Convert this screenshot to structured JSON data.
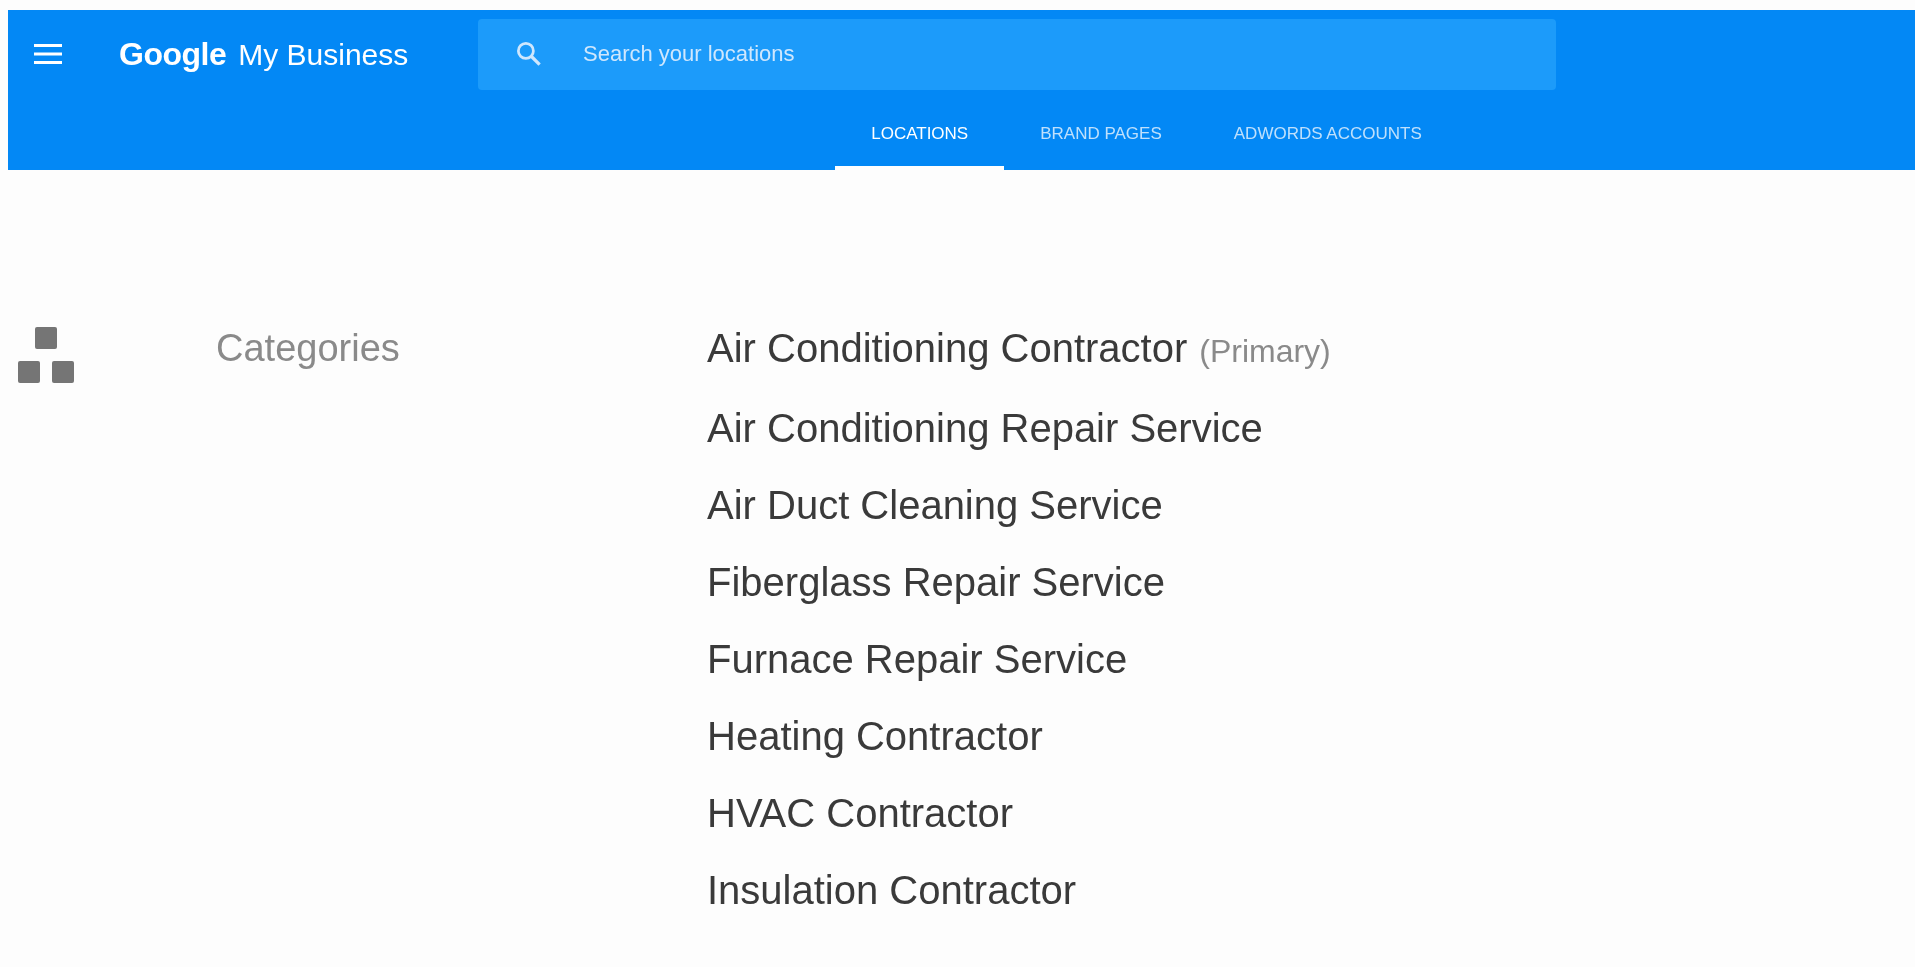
{
  "header": {
    "logo": {
      "brand": "Google",
      "product": "My Business"
    },
    "search": {
      "placeholder": "Search your locations"
    }
  },
  "tabs": [
    {
      "label": "LOCATIONS",
      "selected": true
    },
    {
      "label": "BRAND PAGES",
      "selected": false
    },
    {
      "label": "ADWORDS ACCOUNTS",
      "selected": false
    }
  ],
  "section": {
    "label": "Categories",
    "categories": [
      {
        "name": "Air Conditioning Contractor",
        "tag": "(Primary)"
      },
      {
        "name": "Air Conditioning Repair Service"
      },
      {
        "name": "Air Duct Cleaning Service"
      },
      {
        "name": "Fiberglass Repair Service"
      },
      {
        "name": "Furnace Repair Service"
      },
      {
        "name": "Heating Contractor"
      },
      {
        "name": "HVAC Contractor"
      },
      {
        "name": "Insulation Contractor"
      }
    ]
  }
}
